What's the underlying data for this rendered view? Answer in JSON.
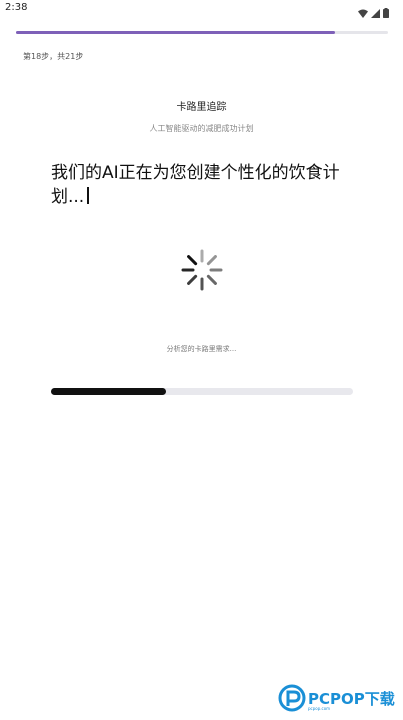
{
  "status_bar": {
    "time": "2:38",
    "icons": [
      "wifi-icon",
      "signal-icon",
      "battery-icon"
    ]
  },
  "progress": {
    "step_label": "第18步，共21步",
    "current_step": 18,
    "total_steps": 21,
    "fraction": 0.857
  },
  "header": {
    "title": "卡路里追踪",
    "subtitle": "人工智能驱动的减肥成功计划"
  },
  "typing": {
    "text": "我们的AI正在为您创建个性化的饮食计划..."
  },
  "loading": {
    "status_text": "分析您的卡路里需求...",
    "fraction": 0.38
  },
  "watermark": {
    "brand": "PCPOP下载",
    "tagline": "pcpop.com"
  },
  "colors": {
    "accent": "#7e60b8",
    "bar_fill": "#111111",
    "bar_track": "#e8e8ed",
    "watermark": "#1a8fd6"
  }
}
